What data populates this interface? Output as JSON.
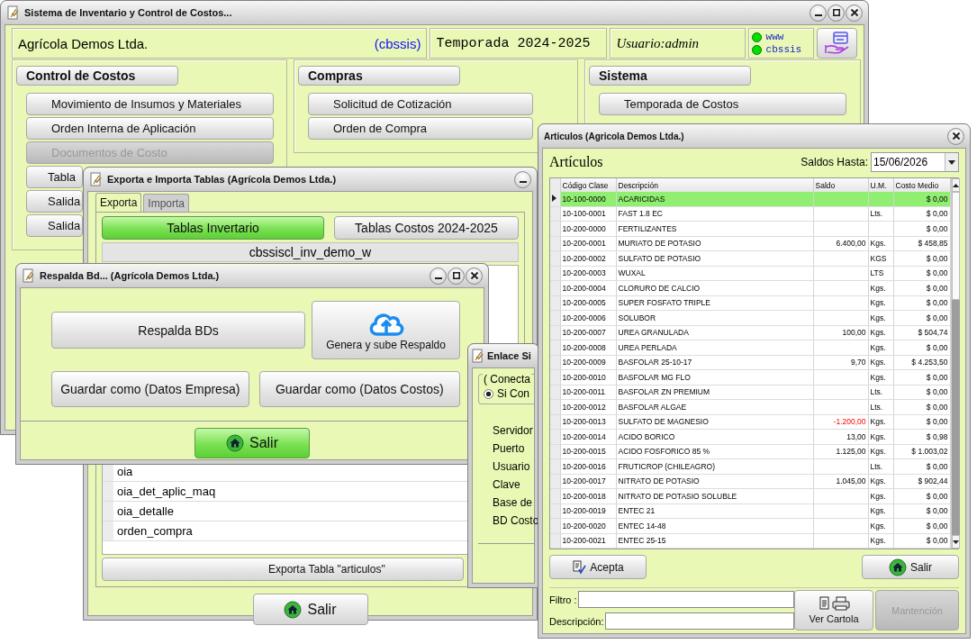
{
  "main_window": {
    "title": "Sistema de Inventario y Control de Costos...",
    "company": "Agrícola Demos Ltda.",
    "db_tag": "(cbssis)",
    "season": "Temporada 2024-2025",
    "user": "Usuario:admin",
    "status": [
      {
        "label": "www",
        "on": true
      },
      {
        "label": "cbssis",
        "on": true
      }
    ],
    "sections": [
      {
        "title": "Control de Costos",
        "buttons": [
          {
            "label": "Movimiento de Insumos y Materiales",
            "disabled": false
          },
          {
            "label": "Orden Interna de Aplicación",
            "disabled": false
          },
          {
            "label": "Documentos de Costo",
            "disabled": true
          },
          {
            "label": "Tabla",
            "disabled": false
          },
          {
            "label": "Salida",
            "disabled": false
          },
          {
            "label": "Salida",
            "disabled": false
          }
        ]
      },
      {
        "title": "Compras",
        "buttons": [
          {
            "label": "Solicitud de Cotización",
            "disabled": false
          },
          {
            "label": "Orden de Compra",
            "disabled": false
          }
        ]
      },
      {
        "title": "Sistema",
        "buttons": [
          {
            "label": "Temporada de Costos",
            "disabled": false
          }
        ]
      }
    ]
  },
  "export_window": {
    "title": "Exporta e Importa Tablas (Agrícola Demos Ltda.)",
    "tabs": [
      {
        "label": "Exporta",
        "selected": true
      },
      {
        "label": "Importa",
        "selected": false
      }
    ],
    "sources": [
      {
        "label": "Tablas Invertario",
        "selected": true
      },
      {
        "label": "Tablas Costos 2024-2025",
        "selected": false
      }
    ],
    "database": "cbssiscl_inv_demo_w",
    "tables": [
      "oia",
      "oia_det_aplic_maq",
      "oia_detalle",
      "orden_compra"
    ],
    "export_button": "Exporta Tabla \"articulos\"",
    "exit_button": {
      "label": "Salir",
      "focused": false
    }
  },
  "backup_window": {
    "title": "Respalda Bd... (Agrícola Demos Ltda.)",
    "backup_button": "Respalda BDs",
    "upload_button": "Genera y sube Respaldo",
    "save_buttons": [
      "Guardar como (Datos Empresa)",
      "Guardar como (Datos Costos)"
    ],
    "exit_button": {
      "label": "Salir",
      "focused": true
    }
  },
  "link_window": {
    "title": "Enlace Si",
    "group_title": "( Conecta",
    "option": {
      "label": "Si Con",
      "selected": true
    },
    "fields": [
      "Servidor",
      "Puerto",
      "Usuario",
      "Clave",
      "Base de",
      "BD Costo"
    ]
  },
  "articles_window": {
    "title": "Articulos (Agricola Demos Ltda.)",
    "heading": "Artículos",
    "date_label": "Saldos Hasta:",
    "date": "15/06/2026",
    "table": {
      "columns": [
        "Código Clase",
        "Descripción",
        "Saldo",
        "U.M.",
        "Costo Medio"
      ],
      "rows": [
        {
          "code": "10-100-0000",
          "description": "ACARICIDAS",
          "cost": "$ 0,00",
          "selected": true
        },
        {
          "code": "10-100-0001",
          "description": "FAST 1.8 EC",
          "unit": "Lts.",
          "cost": "$ 0,00",
          "selected": false
        },
        {
          "code": "10-200-0000",
          "description": "FERTILIZANTES",
          "cost": "$ 0,00",
          "selected": false
        },
        {
          "code": "10-200-0001",
          "description": "MURIATO DE POTASIO",
          "balance": "6.400,00",
          "negative": false,
          "unit": "Kgs.",
          "cost": "$ 458,85",
          "selected": false
        },
        {
          "code": "10-200-0002",
          "description": "SULFATO DE POTASIO",
          "unit": "KGS",
          "cost": "$ 0,00",
          "selected": false
        },
        {
          "code": "10-200-0003",
          "description": "WUXAL",
          "unit": "LTS",
          "cost": "$ 0,00",
          "selected": false
        },
        {
          "code": "10-200-0004",
          "description": "CLORURO DE CALCIO",
          "unit": "Kgs.",
          "cost": "$ 0,00",
          "selected": false
        },
        {
          "code": "10-200-0005",
          "description": "SUPER FOSFATO TRIPLE",
          "unit": "Kgs.",
          "cost": "$ 0,00",
          "selected": false
        },
        {
          "code": "10-200-0006",
          "description": "SOLUBOR",
          "unit": "Kgs.",
          "cost": "$ 0,00",
          "selected": false
        },
        {
          "code": "10-200-0007",
          "description": "UREA GRANULADA",
          "balance": "100,00",
          "negative": false,
          "unit": "Kgs.",
          "cost": "$ 504,74",
          "selected": false
        },
        {
          "code": "10-200-0008",
          "description": "UREA PERLADA",
          "unit": "Kgs.",
          "cost": "$ 0,00",
          "selected": false
        },
        {
          "code": "10-200-0009",
          "description": "BASFOLAR 25-10-17",
          "balance": "9,70",
          "negative": false,
          "unit": "Kgs.",
          "cost": "$ 4.253,50",
          "selected": false
        },
        {
          "code": "10-200-0010",
          "description": "BASFOLAR MG FLO",
          "unit": "Kgs.",
          "cost": "$ 0,00",
          "selected": false
        },
        {
          "code": "10-200-0011",
          "description": "BASFOLAR ZN PREMIUM",
          "unit": "Lts.",
          "cost": "$ 0,00",
          "selected": false
        },
        {
          "code": "10-200-0012",
          "description": "BASFOLAR ALGAE",
          "unit": "Lts.",
          "cost": "$ 0,00",
          "selected": false
        },
        {
          "code": "10-200-0013",
          "description": "SULFATO DE MAGNESIO",
          "balance": "-1.200,00",
          "negative": true,
          "unit": "Kgs.",
          "cost": "$ 0,00",
          "selected": false
        },
        {
          "code": "10-200-0014",
          "description": "ACIDO BORICO",
          "balance": "13,00",
          "negative": false,
          "unit": "Kgs.",
          "cost": "$ 0,98",
          "selected": false
        },
        {
          "code": "10-200-0015",
          "description": "ACIDO FOSFORICO 85 %",
          "balance": "1.125,00",
          "negative": false,
          "unit": "Kgs.",
          "cost": "$ 1.003,02",
          "selected": false
        },
        {
          "code": "10-200-0016",
          "description": "FRUTICROP (CHILEAGRO)",
          "unit": "Lts.",
          "cost": "$ 0,00",
          "selected": false
        },
        {
          "code": "10-200-0017",
          "description": "NITRATO DE POTASIO",
          "balance": "1.045,00",
          "negative": false,
          "unit": "Kgs.",
          "cost": "$ 902,44",
          "selected": false
        },
        {
          "code": "10-200-0018",
          "description": "NITRATO DE POTASIO SOLUBLE",
          "unit": "Kgs.",
          "cost": "$ 0,00",
          "selected": false
        },
        {
          "code": "10-200-0019",
          "description": "ENTEC 21",
          "unit": "Kgs.",
          "cost": "$ 0,00",
          "selected": false
        },
        {
          "code": "10-200-0020",
          "description": "ENTEC 14-48",
          "unit": "Kgs.",
          "cost": "$ 0,00",
          "selected": false
        },
        {
          "code": "10-200-0021",
          "description": "ENTEC 25-15",
          "unit": "Kgs.",
          "cost": "$ 0,00",
          "selected": false
        }
      ]
    },
    "accept_button": "Acepta",
    "exit_button": "Salir",
    "filter_label": "Filtro :",
    "description_label": "Descripción:",
    "statement_button": "Ver Cartola",
    "maintenance_button": {
      "label": "Mantención",
      "disabled": true
    }
  }
}
